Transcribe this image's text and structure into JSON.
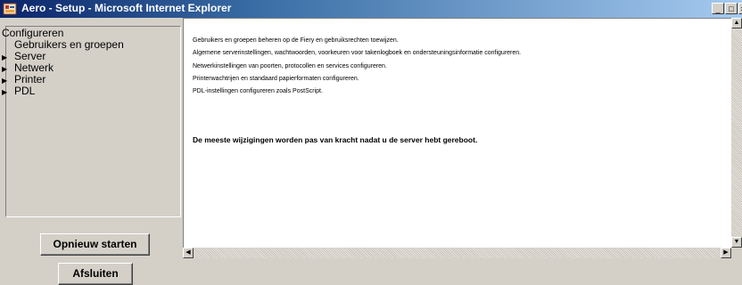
{
  "window": {
    "title": "Aero - Setup - Microsoft Internet Explorer",
    "minimize_glyph": "_",
    "maximize_glyph": "□",
    "close_glyph": "×"
  },
  "sidebar": {
    "root": "Configureren",
    "items": [
      {
        "label": "Gebruikers en groepen",
        "expandable": false
      },
      {
        "label": "Server",
        "expandable": true
      },
      {
        "label": "Netwerk",
        "expandable": true
      },
      {
        "label": "Printer",
        "expandable": true
      },
      {
        "label": "PDL",
        "expandable": true
      }
    ],
    "expand_glyph": "▶"
  },
  "buttons": {
    "restart": "Opnieuw starten",
    "exit": "Afsluiten"
  },
  "content": {
    "lines": [
      "Gebruikers en groepen beheren op de Fiery en gebruiksrechten toewijzen.",
      "Algemene serverinstellingen, wachtwoorden, voorkeuren voor takenlogboek en ondersteuningsinformatie configureren.",
      "Netwerkinstellingen van poorten, protocollen en services configureren.",
      "Printerwachtrijen en standaard papierformaten configureren.",
      "PDL-instellingen configureren zoals PostScript."
    ],
    "warning": "De meeste wijzigingen worden pas van kracht nadat u de server hebt gereboot."
  },
  "scroll": {
    "up": "▲",
    "down": "▼",
    "left": "◀",
    "right": "▶"
  },
  "colors": {
    "titlebar_start": "#0a246a",
    "titlebar_end": "#a6caf0",
    "chrome": "#d4d0c8",
    "content_bg": "#ffffff"
  }
}
